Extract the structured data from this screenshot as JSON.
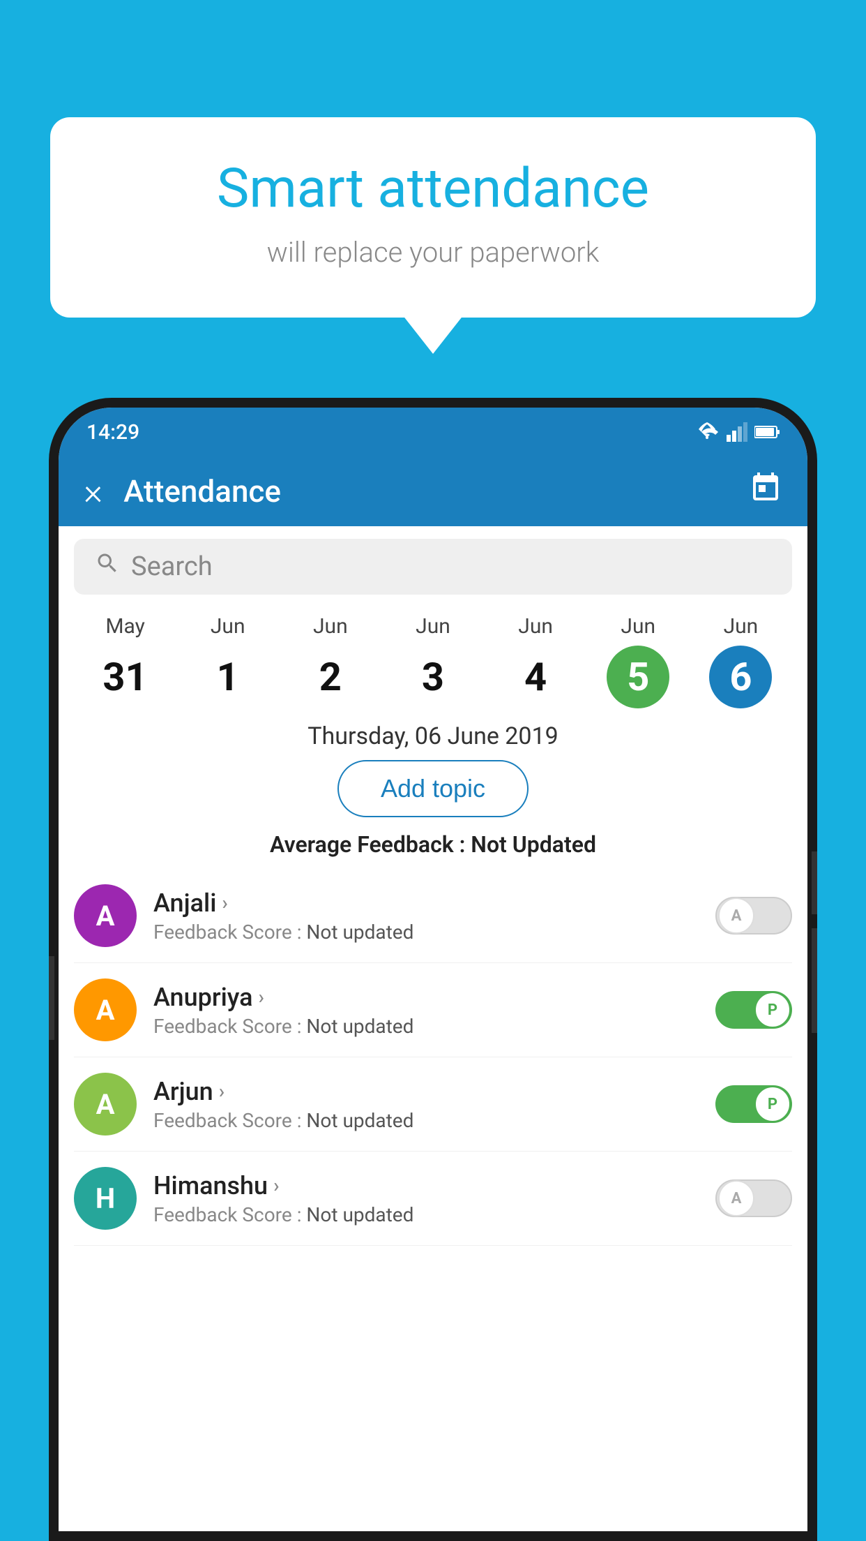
{
  "background_color": "#17b0e0",
  "bubble": {
    "title": "Smart attendance",
    "subtitle": "will replace your paperwork"
  },
  "status_bar": {
    "time": "14:29",
    "icons": [
      "wifi",
      "signal",
      "battery"
    ]
  },
  "app_bar": {
    "title": "Attendance",
    "close_label": "×",
    "calendar_label": "📅"
  },
  "search": {
    "placeholder": "Search"
  },
  "calendar": {
    "days": [
      {
        "month": "May",
        "date": "31",
        "style": "normal"
      },
      {
        "month": "Jun",
        "date": "1",
        "style": "normal"
      },
      {
        "month": "Jun",
        "date": "2",
        "style": "normal"
      },
      {
        "month": "Jun",
        "date": "3",
        "style": "normal"
      },
      {
        "month": "Jun",
        "date": "4",
        "style": "normal"
      },
      {
        "month": "Jun",
        "date": "5",
        "style": "green"
      },
      {
        "month": "Jun",
        "date": "6",
        "style": "blue"
      }
    ]
  },
  "selected_date": "Thursday, 06 June 2019",
  "add_topic_label": "Add topic",
  "avg_feedback": {
    "label": "Average Feedback :",
    "value": "Not Updated"
  },
  "students": [
    {
      "name": "Anjali",
      "avatar_letter": "A",
      "avatar_color": "purple",
      "feedback_label": "Feedback Score :",
      "feedback_value": "Not updated",
      "toggle_state": "off",
      "toggle_letter": "A"
    },
    {
      "name": "Anupriya",
      "avatar_letter": "A",
      "avatar_color": "orange",
      "feedback_label": "Feedback Score :",
      "feedback_value": "Not updated",
      "toggle_state": "on",
      "toggle_letter": "P"
    },
    {
      "name": "Arjun",
      "avatar_letter": "A",
      "avatar_color": "light-green",
      "feedback_label": "Feedback Score :",
      "feedback_value": "Not updated",
      "toggle_state": "on",
      "toggle_letter": "P"
    },
    {
      "name": "Himanshu",
      "avatar_letter": "H",
      "avatar_color": "teal",
      "feedback_label": "Feedback Score :",
      "feedback_value": "Not updated",
      "toggle_state": "off",
      "toggle_letter": "A"
    }
  ]
}
